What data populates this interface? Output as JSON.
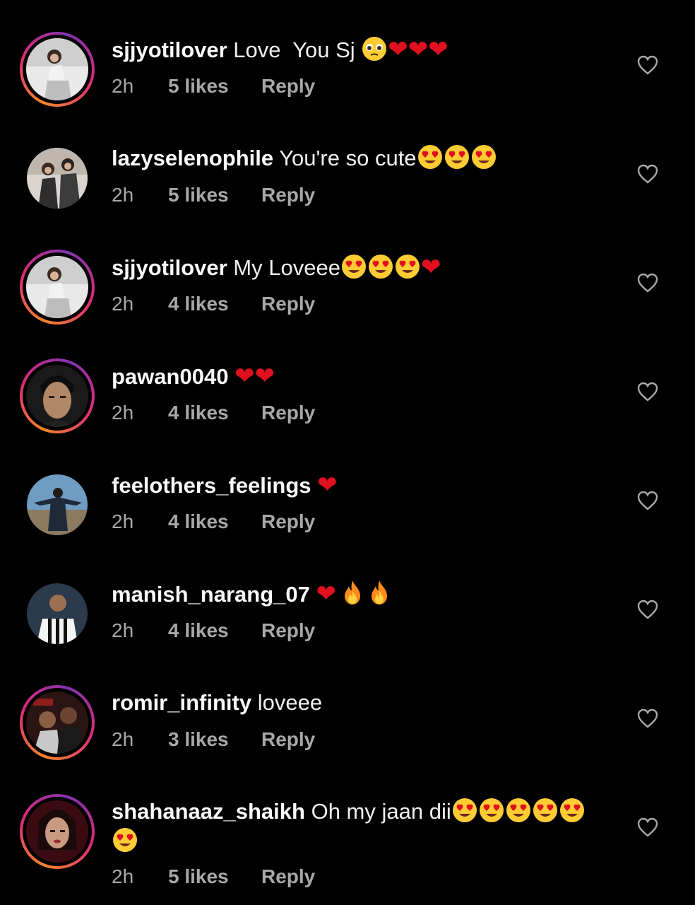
{
  "comments": [
    {
      "username": "sjjyotilover",
      "text": " Love  You Sj ",
      "emojis": [
        "pleading",
        "heart",
        "heart",
        "heart"
      ],
      "time": "2h",
      "likes": "5 likes",
      "reply": "Reply"
    },
    {
      "username": "lazyselenophile",
      "text": " You're so cute",
      "emojis": [
        "hearteyes",
        "hearteyes",
        "hearteyes"
      ],
      "time": "2h",
      "likes": "5 likes",
      "reply": "Reply"
    },
    {
      "username": "sjjyotilover",
      "text": " My Loveee",
      "emojis": [
        "hearteyes",
        "hearteyes",
        "hearteyes",
        "heart"
      ],
      "time": "2h",
      "likes": "4 likes",
      "reply": "Reply"
    },
    {
      "username": "pawan0040",
      "text": " ",
      "emojis": [
        "heart",
        "heart"
      ],
      "time": "2h",
      "likes": "4 likes",
      "reply": "Reply"
    },
    {
      "username": "feelothers_feelings",
      "text": " ",
      "emojis": [
        "heart"
      ],
      "time": "2h",
      "likes": "4 likes",
      "reply": "Reply"
    },
    {
      "username": "manish_narang_07",
      "text": " ",
      "emojis": [
        "heart",
        "fire",
        "fire"
      ],
      "time": "2h",
      "likes": "4 likes",
      "reply": "Reply"
    },
    {
      "username": "romir_infinity",
      "text": " loveee",
      "emojis": [],
      "time": "2h",
      "likes": "3 likes",
      "reply": "Reply"
    },
    {
      "username": "shahanaaz_shaikh",
      "text": " Oh my jaan dii",
      "emojis": [
        "hearteyes",
        "hearteyes",
        "hearteyes",
        "hearteyes",
        "hearteyes"
      ],
      "emojis_line2": [
        "hearteyes"
      ],
      "time": "2h",
      "likes": "5 likes",
      "reply": "Reply"
    }
  ],
  "icons": {
    "like": "heart-outline-icon",
    "avatar_ring_colors": [
      "#f58529",
      "#dd2a7b",
      "#8134af"
    ],
    "emoji_heart_color": "#e0101f",
    "emoji_face_color": "#ffcc33"
  }
}
